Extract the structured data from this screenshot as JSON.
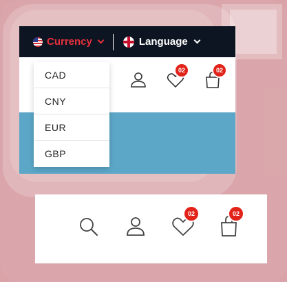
{
  "header": {
    "currency_label": "Currency",
    "language_label": "Language",
    "wishlist_count": "02",
    "cart_count": "02"
  },
  "currency_menu": {
    "options": [
      "CAD",
      "CNY",
      "EUR",
      "GBP"
    ]
  },
  "icon_bar": {
    "wishlist_count": "02",
    "cart_count": "02"
  },
  "colors": {
    "accent_red": "#e6313c",
    "topbar_bg": "#0e1522",
    "badge_red": "#e2231a",
    "page_bg": "#d9a3a8"
  },
  "icons": [
    "us-flag-icon",
    "uk-flag-icon",
    "chevron-down-icon",
    "user-icon",
    "heart-icon",
    "shopping-bag-icon",
    "search-icon"
  ]
}
